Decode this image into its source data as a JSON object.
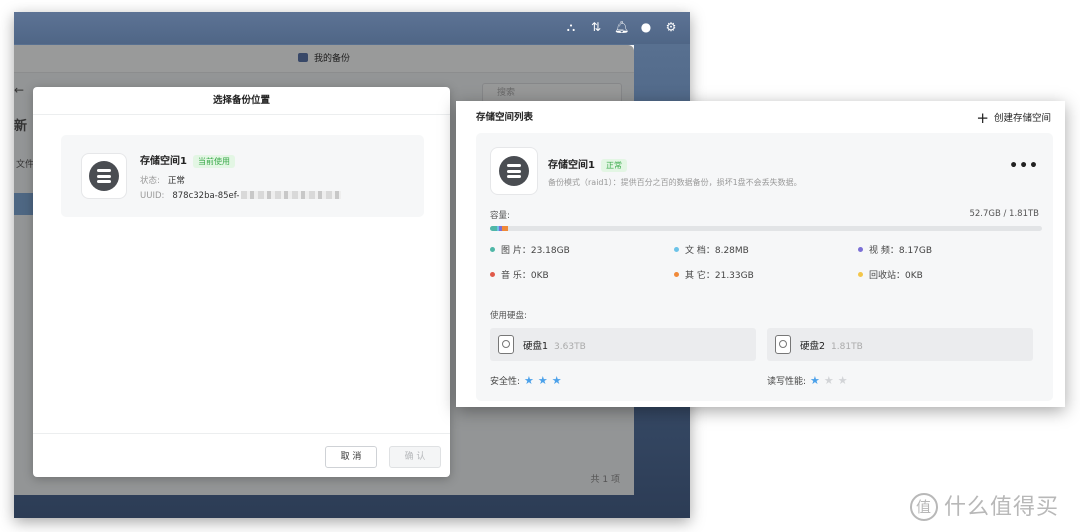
{
  "desktop": {
    "app_title": "我的备份",
    "search_placeholder": "搜索",
    "side_labels": [
      "←",
      "新",
      "文件"
    ],
    "footer_text": "共 1 项",
    "tray_icons": [
      "network-icon",
      "transfer-icon",
      "bell-icon",
      "user-icon",
      "settings-icon"
    ]
  },
  "modal": {
    "title": "选择备份位置",
    "pool": {
      "name": "存储空间1",
      "badge": "当前使用",
      "status_label": "状态:",
      "status_value": "正常",
      "uuid_label": "UUID:",
      "uuid_value": "878c32ba-85ef-"
    },
    "cancel_label": "取 消",
    "confirm_label": "确 认"
  },
  "storage_panel": {
    "title": "存储空间列表",
    "create_label": "创建存储空间",
    "pool": {
      "name": "存储空间1",
      "badge": "正常",
      "description": "备份模式（raid1）：提供百分之百的数据备份，损坏1盘不会丢失数据。"
    },
    "capacity_label": "容量:",
    "capacity_value": "52.7GB / 1.81TB",
    "capacity_segments": [
      {
        "name": "图片",
        "fraction": 0.0125,
        "color": "#4fb7a7"
      },
      {
        "name": "文档",
        "fraction": 0.0045,
        "color": "#6cc3e8"
      },
      {
        "name": "视频",
        "fraction": 0.0044,
        "color": "#7b6fd6"
      },
      {
        "name": "音乐",
        "fraction": 0.0,
        "color": "#e05a4a"
      },
      {
        "name": "其它",
        "fraction": 0.0115,
        "color": "#f08a3a"
      },
      {
        "name": "回收站",
        "fraction": 0.0,
        "color": "#f3c64a"
      }
    ],
    "categories": [
      {
        "label": "图 片：23.18GB",
        "color": "#4fb7a7"
      },
      {
        "label": "文 档：8.28MB",
        "color": "#6cc3e8"
      },
      {
        "label": "视 频：8.17GB",
        "color": "#7b6fd6"
      },
      {
        "label": "音 乐：0KB",
        "color": "#e05a4a"
      },
      {
        "label": "其 它：21.33GB",
        "color": "#f08a3a"
      },
      {
        "label": "回收站：0KB",
        "color": "#f3c64a"
      }
    ],
    "disks_label": "使用硬盘:",
    "disks": [
      {
        "name": "硬盘1",
        "size": "3.63TB"
      },
      {
        "name": "硬盘2",
        "size": "1.81TB"
      }
    ],
    "safety_label": "安全性:",
    "safety_stars": 3,
    "rw_label": "读写性能:",
    "rw_stars": 1
  },
  "watermark": {
    "circle_char": "值",
    "text": "什么值得买"
  }
}
